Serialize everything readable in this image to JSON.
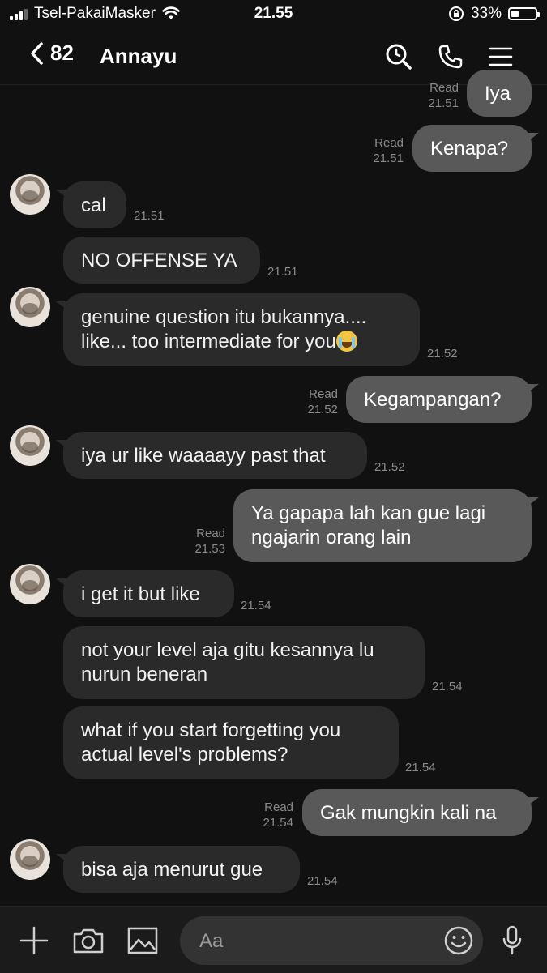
{
  "status_bar": {
    "carrier": "Tsel-PakaiMasker",
    "time": "21.55",
    "battery": "33%",
    "battery_level": 0.33
  },
  "header": {
    "back_count": "82",
    "title": "Annayu",
    "icons": [
      "search-icon",
      "phone-icon",
      "menu-icon"
    ]
  },
  "messages": [
    {
      "dir": "out",
      "text": "Iya",
      "read": "Read",
      "time": "21.51"
    },
    {
      "dir": "out",
      "text": "Kenapa?",
      "read": "Read",
      "time": "21.51"
    },
    {
      "dir": "in",
      "text": "cal",
      "time": "21.51"
    },
    {
      "dir": "in",
      "text": "NO OFFENSE YA",
      "time": "21.51"
    },
    {
      "dir": "in",
      "text_line1": "genuine question itu bukannya....",
      "text_line2": "like... too intermediate for you",
      "emoji": "loudly-crying-face-emoji",
      "time": "21.52"
    },
    {
      "dir": "out",
      "text": "Kegampangan?",
      "read": "Read",
      "time": "21.52"
    },
    {
      "dir": "in",
      "text": "iya ur like waaaayy past that",
      "time": "21.52"
    },
    {
      "dir": "out",
      "text_line1": "Ya gapapa lah kan gue lagi",
      "text_line2": "ngajarin orang lain",
      "read": "Read",
      "time": "21.53"
    },
    {
      "dir": "in",
      "text": "i get it but like",
      "time": "21.54"
    },
    {
      "dir": "in",
      "text_line1": "not your level aja gitu kesannya lu",
      "text_line2": "nurun beneran",
      "time": "21.54"
    },
    {
      "dir": "in",
      "text_line1": "what if you start forgetting you",
      "text_line2": "actual level's problems?",
      "time": "21.54"
    },
    {
      "dir": "out",
      "text": "Gak mungkin kali na",
      "read": "Read",
      "time": "21.54"
    },
    {
      "dir": "in",
      "text": "bisa aja menurut gue",
      "time": "21.54"
    }
  ],
  "composer": {
    "placeholder": "Aa",
    "icons": [
      "plus-icon",
      "camera-icon",
      "image-icon",
      "smiley-icon",
      "microphone-icon"
    ]
  },
  "colors": {
    "background": "#111111",
    "incoming_bubble": "#2a2a2a",
    "outgoing_bubble": "#595959",
    "meta_text": "#8a8a8a"
  }
}
